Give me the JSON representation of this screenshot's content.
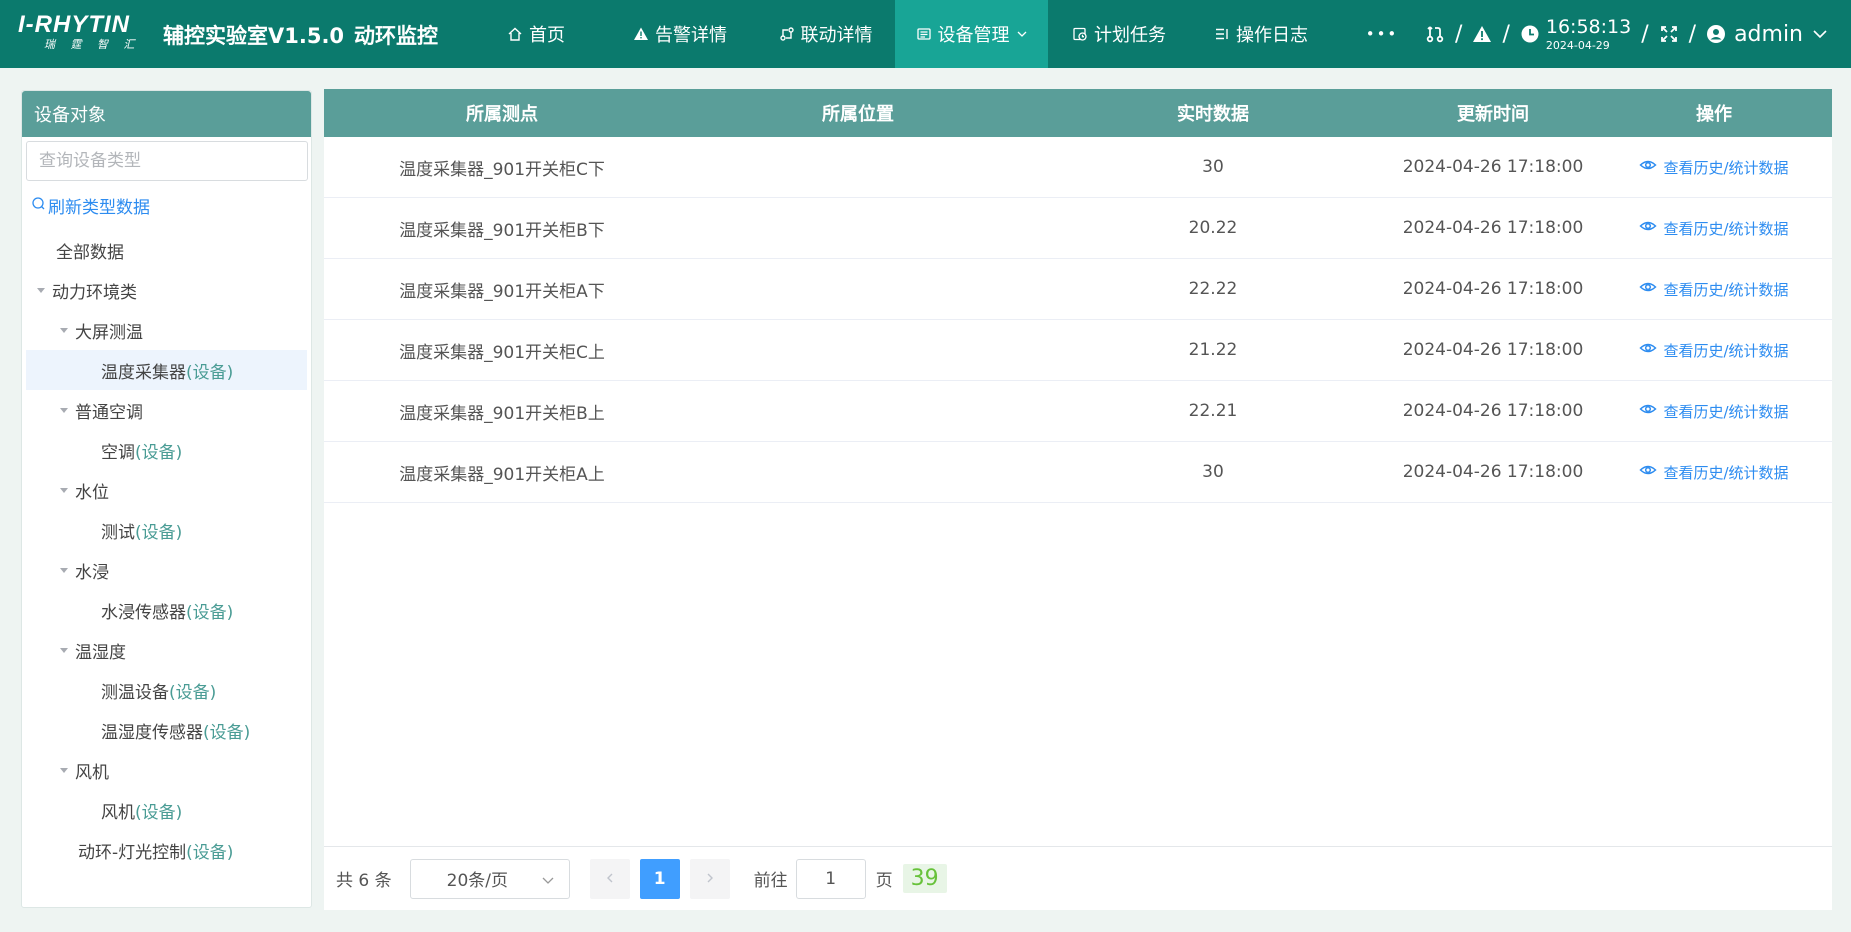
{
  "header": {
    "logo_main": "I-RHYTIN",
    "logo_sub": "瑞 霆 智 汇",
    "app_title": "辅控实验室V1.5.0",
    "app_subtitle": "动环监控",
    "nav": [
      {
        "label": "首页",
        "icon": "home-icon"
      },
      {
        "label": "告警详情",
        "icon": "warning-icon"
      },
      {
        "label": "联动详情",
        "icon": "link-icon"
      },
      {
        "label": "设备管理",
        "icon": "device-icon",
        "active": true
      },
      {
        "label": "计划任务",
        "icon": "clock-calendar-icon"
      },
      {
        "label": "操作日志",
        "icon": "log-icon"
      }
    ],
    "more_label": "•••",
    "separator": "/",
    "time": "16:58:13",
    "date": "2024-04-29",
    "user": "admin",
    "colors": {
      "bar": "#0b7a6d",
      "active": "#18a596"
    }
  },
  "sidebar": {
    "title": "设备对象",
    "search_placeholder": "查询设备类型",
    "refresh_label": "刷新类型数据",
    "tree": [
      {
        "label": "全部数据",
        "tag": "",
        "level": 0,
        "toggle": false
      },
      {
        "label": "动力环境类",
        "tag": "",
        "level": 0,
        "toggle": true
      },
      {
        "label": "大屏测温",
        "tag": "",
        "level": 1,
        "toggle": true
      },
      {
        "label": "温度采集器",
        "tag": "(设备)",
        "level": 2,
        "toggle": false,
        "selected": true
      },
      {
        "label": "普通空调",
        "tag": "",
        "level": 1,
        "toggle": true
      },
      {
        "label": "空调",
        "tag": "(设备)",
        "level": 2,
        "toggle": false
      },
      {
        "label": "水位",
        "tag": "",
        "level": 1,
        "toggle": true
      },
      {
        "label": "测试",
        "tag": "(设备)",
        "level": 2,
        "toggle": false
      },
      {
        "label": "水浸",
        "tag": "",
        "level": 1,
        "toggle": true
      },
      {
        "label": "水浸传感器",
        "tag": "(设备)",
        "level": 2,
        "toggle": false
      },
      {
        "label": "温湿度",
        "tag": "",
        "level": 1,
        "toggle": true
      },
      {
        "label": "测温设备",
        "tag": "(设备)",
        "level": 2,
        "toggle": false
      },
      {
        "label": "温湿度传感器",
        "tag": "(设备)",
        "level": 2,
        "toggle": false
      },
      {
        "label": "风机",
        "tag": "",
        "level": 1,
        "toggle": true
      },
      {
        "label": "风机",
        "tag": "(设备)",
        "level": 2,
        "toggle": false
      },
      {
        "label": "动环-灯光控制",
        "tag": "(设备)",
        "level": 1,
        "toggle": false
      }
    ]
  },
  "table": {
    "columns": [
      "所属测点",
      "所属位置",
      "实时数据",
      "更新时间",
      "操作"
    ],
    "rows": [
      {
        "point": "温度采集器_901开关柜C下",
        "location": "",
        "value": "30",
        "time": "2024-04-26 17:18:00",
        "action": "查看历史/统计数据"
      },
      {
        "point": "温度采集器_901开关柜B下",
        "location": "",
        "value": "20.22",
        "time": "2024-04-26 17:18:00",
        "action": "查看历史/统计数据"
      },
      {
        "point": "温度采集器_901开关柜A下",
        "location": "",
        "value": "22.22",
        "time": "2024-04-26 17:18:00",
        "action": "查看历史/统计数据"
      },
      {
        "point": "温度采集器_901开关柜C上",
        "location": "",
        "value": "21.22",
        "time": "2024-04-26 17:18:00",
        "action": "查看历史/统计数据"
      },
      {
        "point": "温度采集器_901开关柜B上",
        "location": "",
        "value": "22.21",
        "time": "2024-04-26 17:18:00",
        "action": "查看历史/统计数据"
      },
      {
        "point": "温度采集器_901开关柜A上",
        "location": "",
        "value": "30",
        "time": "2024-04-26 17:18:00",
        "action": "查看历史/统计数据"
      }
    ],
    "header_color": "#5a9e99"
  },
  "pager": {
    "total": "共 6 条",
    "page_size": "20条/页",
    "current_page": "1",
    "goto_label": "前往",
    "goto_value": "1",
    "page_unit": "页",
    "badge": "39"
  }
}
